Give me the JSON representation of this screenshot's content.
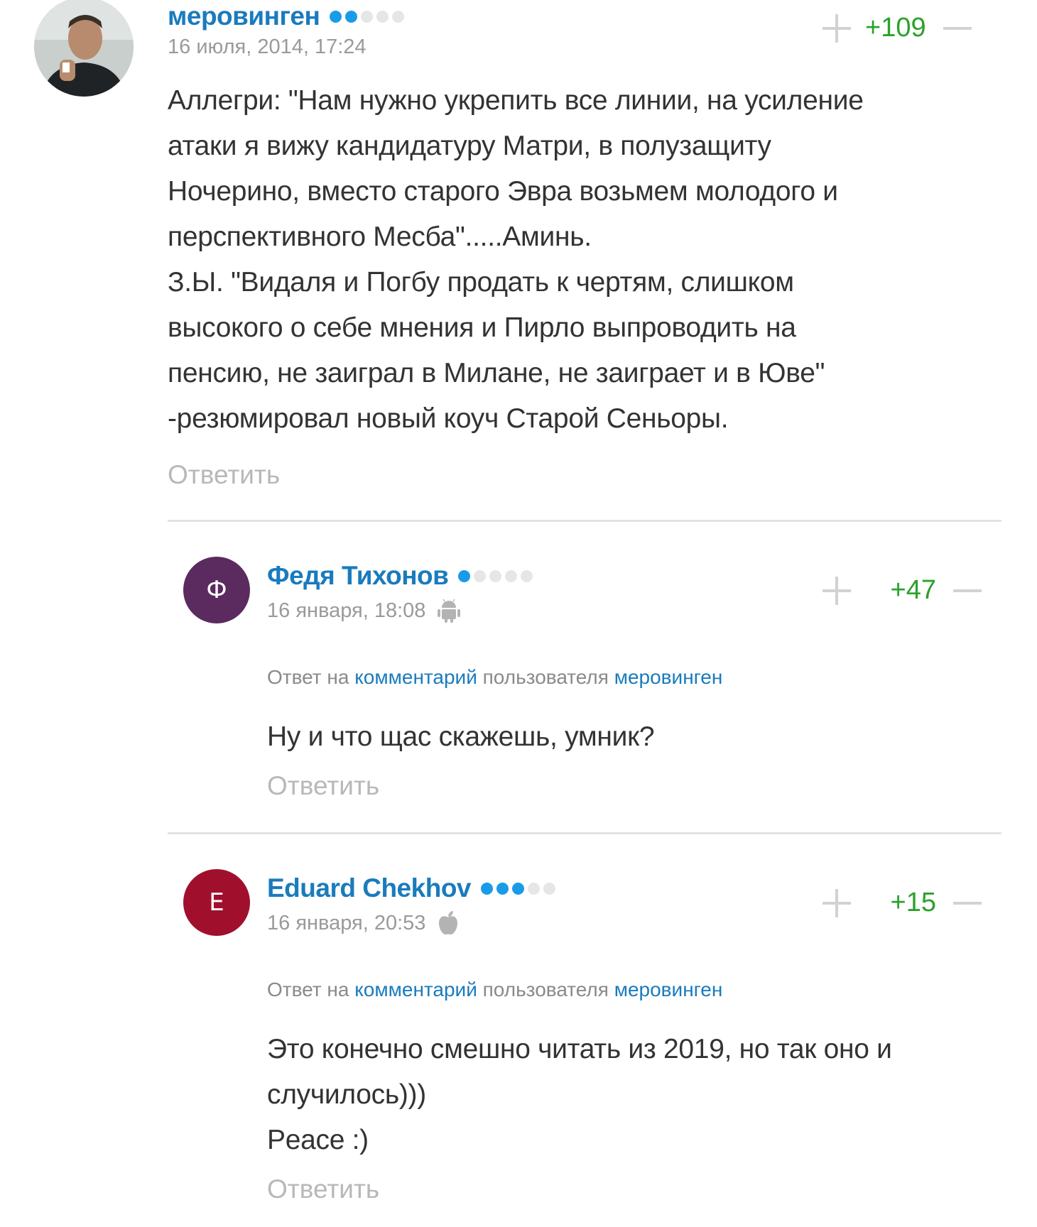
{
  "comments": [
    {
      "author": "меровинген",
      "reputation_dots": 2,
      "date": "16 июля, 2014, 17:24",
      "score": "+109",
      "text_lines": [
        "Аллегри: \"Нам нужно укрепить все линии, на усиление",
        "атаки я вижу кандидатуру Матри, в полузащиту",
        "Ночерино, вместо старого Эвра возьмем молодого и",
        "перспективного Месба\".....Аминь.",
        "З.Ы. \"Видаля и Погбу продать к чертям, слишком",
        "высокого о себе мнения и Пирло выпроводить на",
        "пенсию, не заиграл в Милане, не заиграет и в Юве\"",
        "-резюмировал новый коуч Старой Сеньоры."
      ],
      "reply_label": "Ответить"
    },
    {
      "author": "Федя Тихонов",
      "avatar_letter": "Ф",
      "avatar_color": "#5b2a5e",
      "reputation_dots": 1,
      "date": "16 января, 18:08",
      "platform_icon": "android-icon",
      "score": "+47",
      "reply_to": {
        "prefix": "Ответ на",
        "comment_link": "комментарий",
        "middle": "пользователя",
        "user_link": "меровинген"
      },
      "text_lines": [
        "Ну и что щас скажешь, умник?"
      ],
      "reply_label": "Ответить"
    },
    {
      "author": "Eduard Chekhov",
      "avatar_letter": "E",
      "avatar_color": "#a0102d",
      "reputation_dots": 3,
      "date": "16 января, 20:53",
      "platform_icon": "apple-icon",
      "score": "+15",
      "reply_to": {
        "prefix": "Ответ на",
        "comment_link": "комментарий",
        "middle": "пользователя",
        "user_link": "меровинген"
      },
      "text_lines": [
        "Это конечно смешно читать из 2019, но так оно и",
        "случилось)))",
        "Peace :)"
      ],
      "reply_label": "Ответить"
    }
  ],
  "colors": {
    "author_link": "#1a7bbd",
    "score_positive": "#2ca12c",
    "reputation_on": "#1a9be8",
    "reputation_off": "#e6e6e6"
  }
}
